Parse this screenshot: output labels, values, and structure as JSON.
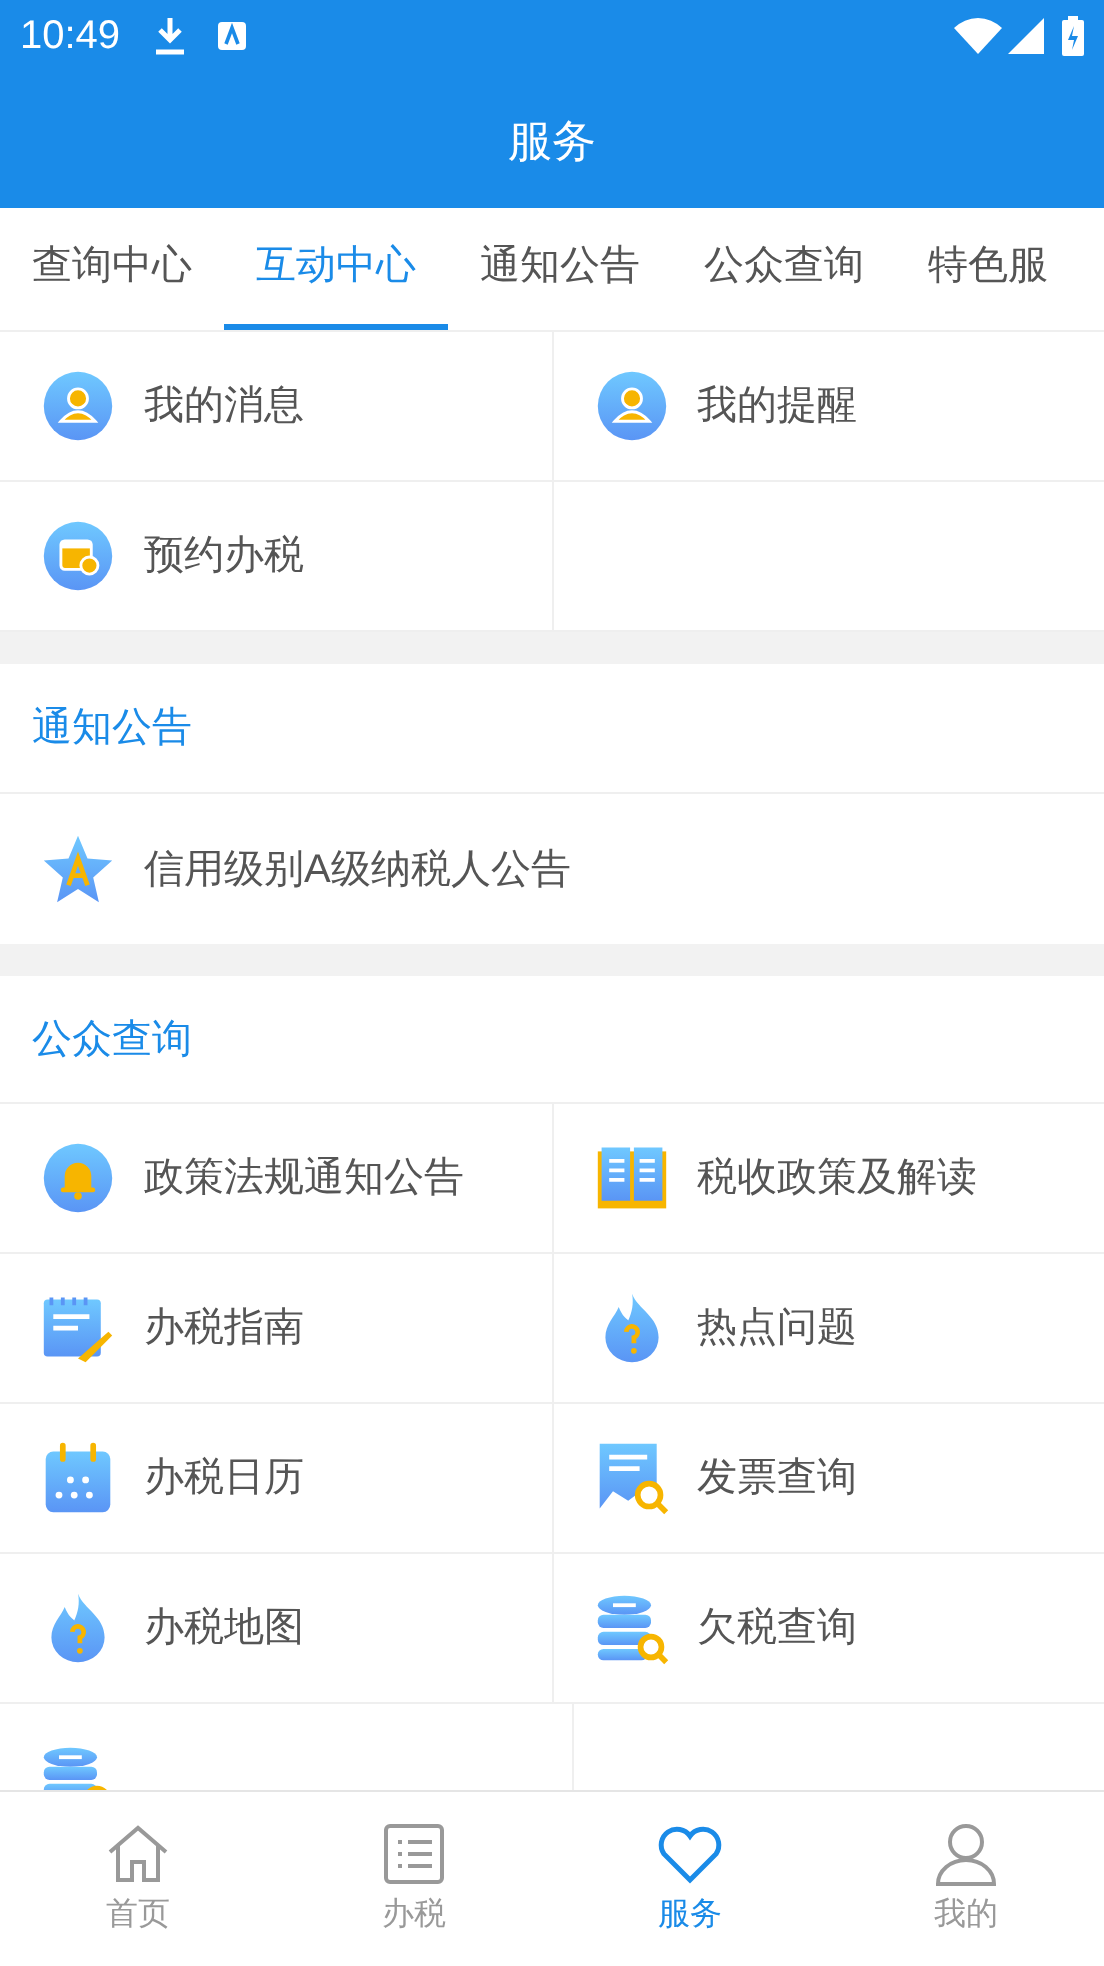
{
  "status_bar": {
    "time": "10:49"
  },
  "header": {
    "title": "服务"
  },
  "tabs": [
    {
      "label": "查询中心",
      "selected": false
    },
    {
      "label": "互动中心",
      "selected": true
    },
    {
      "label": "通知公告",
      "selected": false
    },
    {
      "label": "公众查询",
      "selected": false
    },
    {
      "label": "特色服",
      "selected": false
    }
  ],
  "interactive_center": {
    "items": [
      {
        "label": "我的消息"
      },
      {
        "label": "我的提醒"
      },
      {
        "label": "预约办税"
      }
    ]
  },
  "notices": {
    "title": "通知公告",
    "items": [
      {
        "label": "信用级别A级纳税人公告"
      }
    ]
  },
  "public_query": {
    "title": "公众查询",
    "items": [
      {
        "label": "政策法规通知公告"
      },
      {
        "label": "税收政策及解读"
      },
      {
        "label": "办税指南"
      },
      {
        "label": "热点问题"
      },
      {
        "label": "办税日历"
      },
      {
        "label": "发票查询"
      },
      {
        "label": "办税地图"
      },
      {
        "label": "欠税查询"
      }
    ]
  },
  "bottom_nav": [
    {
      "label": "首页",
      "selected": false
    },
    {
      "label": "办税",
      "selected": false
    },
    {
      "label": "服务",
      "selected": true
    },
    {
      "label": "我的",
      "selected": false
    }
  ]
}
